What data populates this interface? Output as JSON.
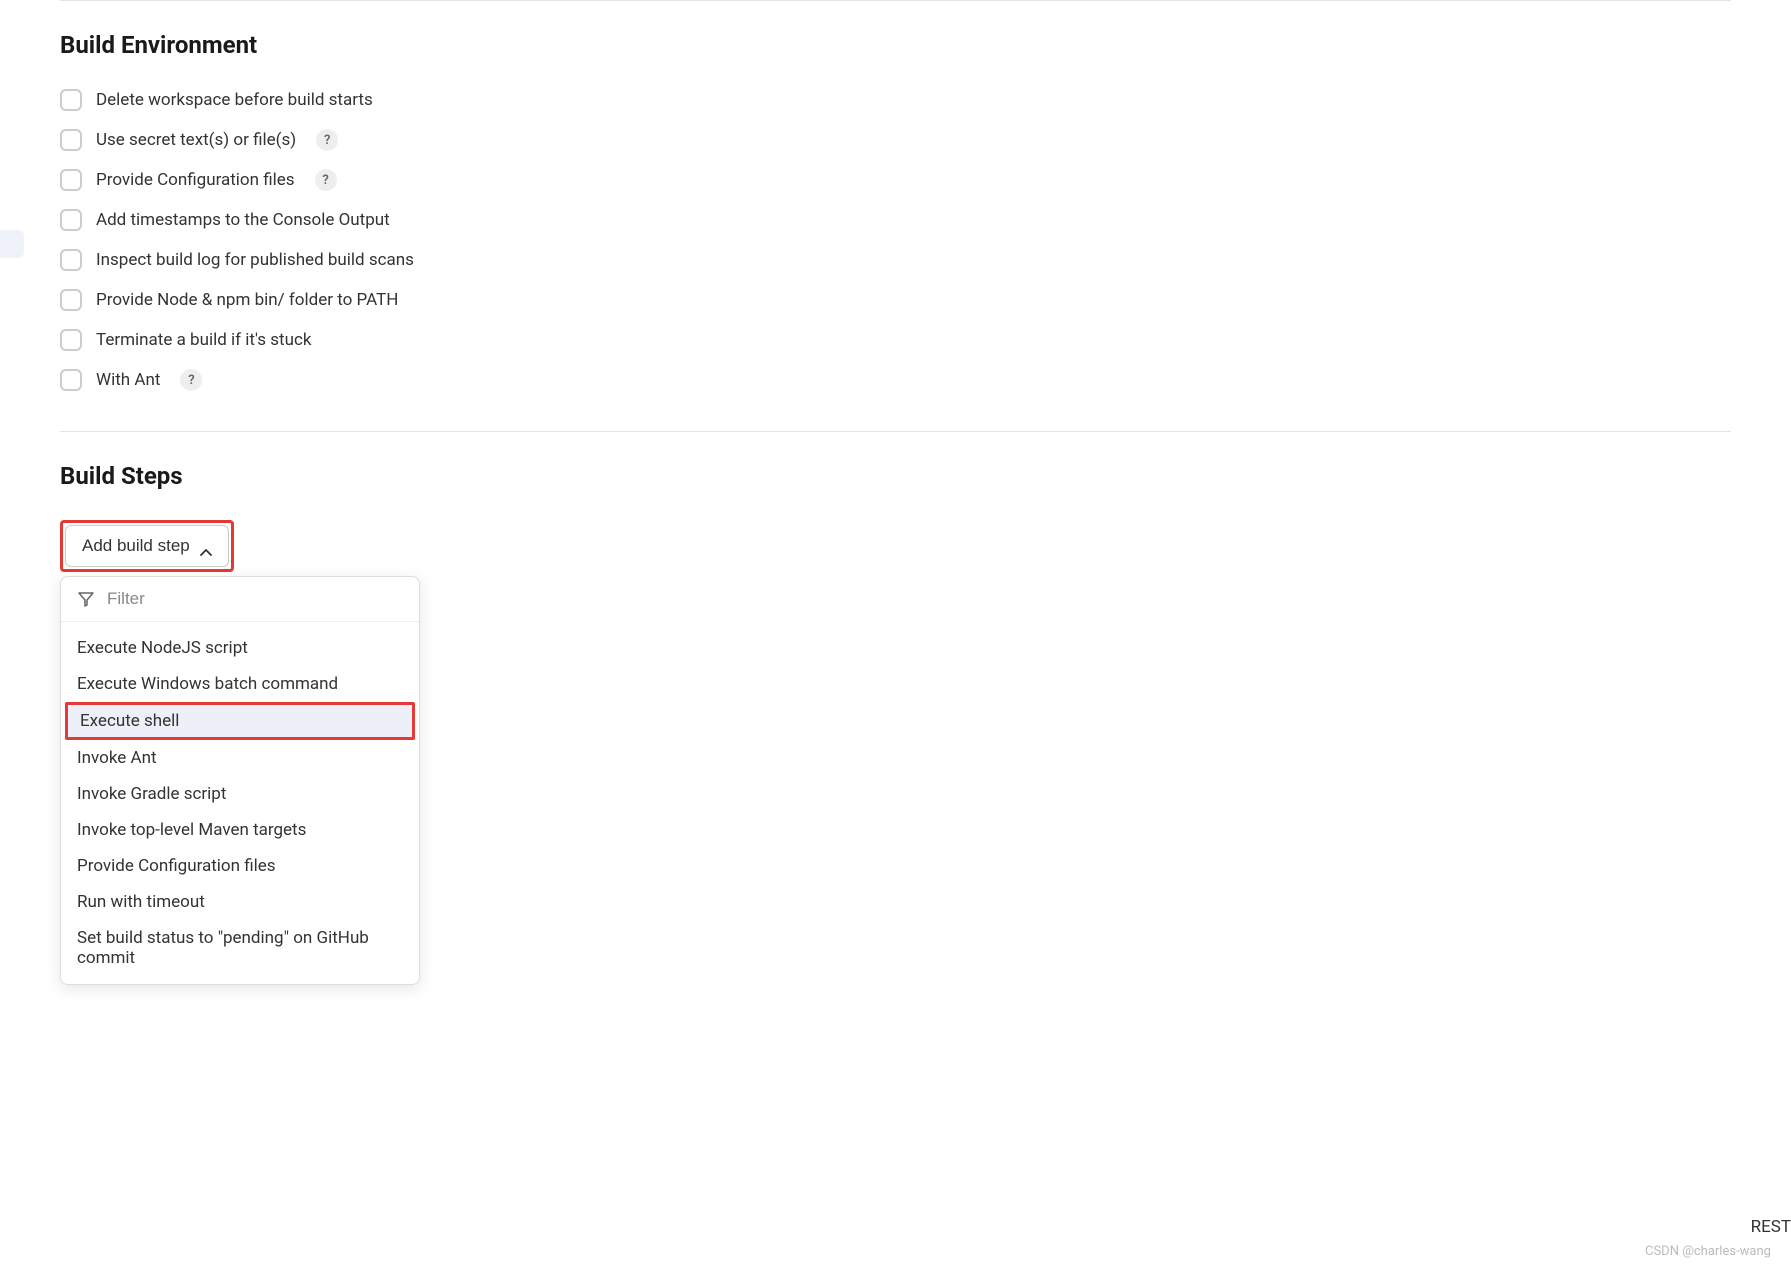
{
  "sections": {
    "build_environment": {
      "title": "Build Environment",
      "options": [
        {
          "label": "Delete workspace before build starts",
          "help": false
        },
        {
          "label": "Use secret text(s) or file(s)",
          "help": true
        },
        {
          "label": "Provide Configuration files",
          "help": true
        },
        {
          "label": "Add timestamps to the Console Output",
          "help": false
        },
        {
          "label": "Inspect build log for published build scans",
          "help": false
        },
        {
          "label": "Provide Node & npm bin/ folder to PATH",
          "help": false
        },
        {
          "label": "Terminate a build if it's stuck",
          "help": false
        },
        {
          "label": "With Ant",
          "help": true
        }
      ]
    },
    "build_steps": {
      "title": "Build Steps",
      "dropdown_label": "Add build step",
      "filter_placeholder": "Filter",
      "menu_items": [
        "Execute NodeJS script",
        "Execute Windows batch command",
        "Execute shell",
        "Invoke Ant",
        "Invoke Gradle script",
        "Invoke top-level Maven targets",
        "Provide Configuration files",
        "Run with timeout",
        "Set build status to \"pending\" on GitHub commit"
      ],
      "selected_index": 2
    }
  },
  "help_glyph": "?",
  "bottom_right": "REST",
  "watermark": "CSDN @charles-wang"
}
